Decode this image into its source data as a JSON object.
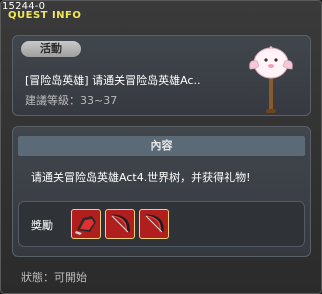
{
  "window": {
    "quest_id": "15244-0",
    "title": "QUEST INFO"
  },
  "quest": {
    "badge": "活動",
    "name": "[冒险岛英雄] 请通关冒险岛英雄Ac..",
    "level": "建議等級：33~37"
  },
  "content": {
    "header": "內容",
    "description": "请通关冒险岛英雄Act4.世界树，并获得礼物!"
  },
  "rewards": {
    "label": "獎勵",
    "items": [
      {
        "icon": "red-glove-item-icon"
      },
      {
        "icon": "red-bow-item-icon"
      },
      {
        "icon": "red-bow-item-icon"
      }
    ]
  },
  "status": {
    "text": "狀態：可開始"
  },
  "colors": {
    "title": "#f2e65a",
    "reward_slot": "#b01e1e",
    "slot_border": "#f0d080",
    "header_bar": "#5c6a78"
  }
}
